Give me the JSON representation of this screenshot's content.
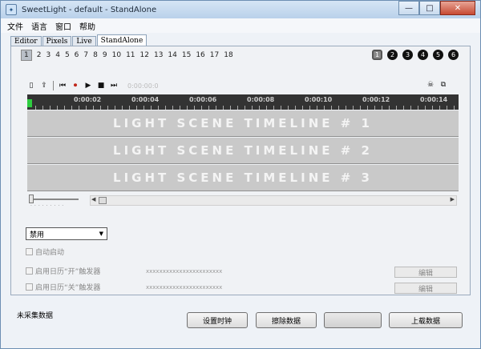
{
  "window": {
    "title": "SweetLight - default - StandAlone"
  },
  "title_buttons": {
    "minimize": "—",
    "maximize": "□",
    "close": "✕"
  },
  "menu": [
    "文件",
    "语言",
    "窗口",
    "帮助"
  ],
  "tabs": [
    "Editor",
    "Pixels",
    "Live",
    "StandAlone"
  ],
  "scene_numbers": [
    "1",
    "2",
    "3",
    "4",
    "5",
    "6",
    "7",
    "8",
    "9",
    "10",
    "11",
    "12",
    "13",
    "14",
    "15",
    "16",
    "17",
    "18"
  ],
  "selected_scene": "1",
  "channel_circles": [
    "1",
    "2",
    "3",
    "4",
    "5",
    "6"
  ],
  "toolbar": {
    "counter": "0:00:00:0"
  },
  "ruler": {
    "labels": [
      "0:00:02",
      "0:00:04",
      "0:00:06",
      "0:00:08",
      "0:00:10",
      "0:00:12",
      "0:00:14"
    ]
  },
  "timelines": [
    "LIGHT SCENE TIMELINE # 1",
    "LIGHT SCENE TIMELINE # 2",
    "LIGHT SCENE TIMELINE # 3"
  ],
  "dropdown": {
    "value": "禁用"
  },
  "options": {
    "auto_start": "自动启动",
    "calendar_on": "启用日历“开”触发器",
    "calendar_off": "启用日历“关”触发器",
    "placeholder": "xxxxxxxxxxxxxxxxxxxxxxx",
    "edit": "编辑"
  },
  "status": "未采集数据",
  "buttons": {
    "set_clock": "设置时钟",
    "erase": "擦除数据",
    "blank": "",
    "upload": "上载数据"
  },
  "colors": {
    "ruler_bg": "#333333",
    "timeline_bg": "#c9c9c9",
    "cursor": "#2ecc40"
  }
}
